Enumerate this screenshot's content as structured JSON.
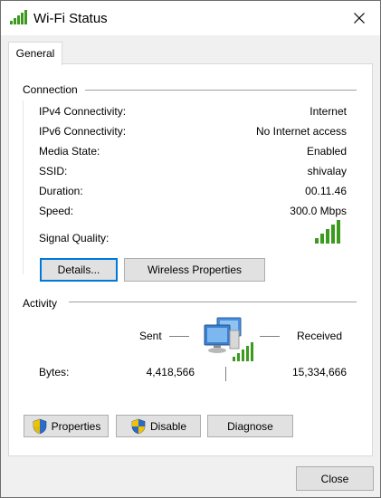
{
  "window": {
    "title": "Wi-Fi Status",
    "close_glyph": "✕"
  },
  "tabs": [
    {
      "label": "General",
      "active": true
    }
  ],
  "connection": {
    "title": "Connection",
    "rows": [
      {
        "label": "IPv4 Connectivity:",
        "value": "Internet"
      },
      {
        "label": "IPv6 Connectivity:",
        "value": "No Internet access"
      },
      {
        "label": "Media State:",
        "value": "Enabled"
      },
      {
        "label": "SSID:",
        "value": "shivalay"
      },
      {
        "label": "Duration:",
        "value": "00.11.46"
      },
      {
        "label": "Speed:",
        "value": "300.0 Mbps"
      }
    ],
    "signal_label": "Signal Quality:",
    "signal_bars_filled": 5,
    "details_label": "Details...",
    "wireless_properties_label": "Wireless Properties"
  },
  "activity": {
    "title": "Activity",
    "sent_label": "Sent",
    "received_label": "Received",
    "bytes_label": "Bytes:",
    "bytes_sent": "4,418,566",
    "bytes_received": "15,334,666"
  },
  "buttons": {
    "properties_label": "Properties",
    "disable_label": "Disable",
    "diagnose_label": "Diagnose",
    "close_label": "Close"
  },
  "colors": {
    "signal_green": "#3c9a1e",
    "shield_blue": "#2b6cc4",
    "shield_yellow": "#f2c200",
    "focus_blue": "#0078d7"
  }
}
